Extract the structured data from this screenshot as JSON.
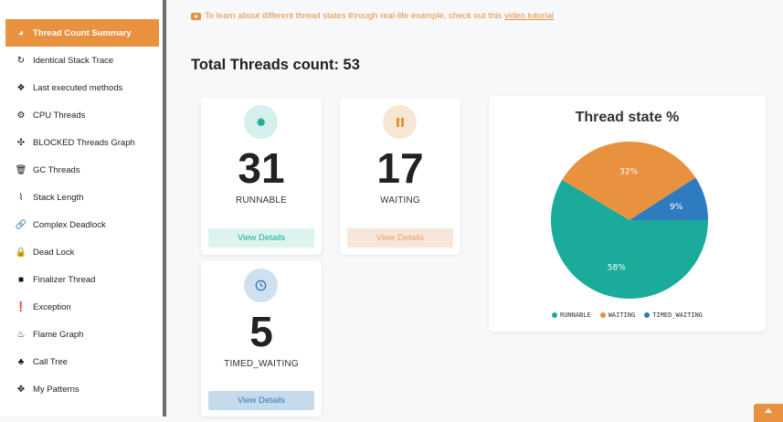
{
  "sidebar": {
    "items": [
      {
        "label": "Thread Count Summary",
        "icon": "dashboard-icon",
        "active": true
      },
      {
        "label": "Identical Stack Trace",
        "icon": "refresh-icon"
      },
      {
        "label": "Last executed methods",
        "icon": "cubes-icon"
      },
      {
        "label": "CPU Threads",
        "icon": "gears-icon"
      },
      {
        "label": "BLOCKED Threads Graph",
        "icon": "graph-icon"
      },
      {
        "label": "GC Threads",
        "icon": "trash-icon"
      },
      {
        "label": "Stack Length",
        "icon": "stairs-icon"
      },
      {
        "label": "Complex Deadlock",
        "icon": "link-icon"
      },
      {
        "label": "Dead Lock",
        "icon": "lock-icon"
      },
      {
        "label": "Finalizer Thread",
        "icon": "square-icon"
      },
      {
        "label": "Exception",
        "icon": "exclamation-icon"
      },
      {
        "label": "Flame Graph",
        "icon": "fire-icon"
      },
      {
        "label": "Call Tree",
        "icon": "tree-icon"
      },
      {
        "label": "My Patterns",
        "icon": "puzzle-icon"
      }
    ]
  },
  "notice": {
    "text": "To learn about different thread states through real-life example, check out this",
    "link": "video tutorial"
  },
  "total": "Total Threads count: 53",
  "cards": {
    "runnable": {
      "count": "31",
      "label": "RUNNABLE",
      "button": "View Details",
      "color": "#1aab9b"
    },
    "waiting": {
      "count": "17",
      "label": "WAITING",
      "button": "View Details",
      "color": "#e8913f"
    },
    "timed_waiting": {
      "count": "5",
      "label": "TIMED_WAITING",
      "button": "View Details",
      "color": "#2f7bbf"
    }
  },
  "chart_data": {
    "type": "pie",
    "title": "Thread state %",
    "categories": [
      "RUNNABLE",
      "WAITING",
      "TIMED_WAITING"
    ],
    "values": [
      58,
      32,
      9
    ],
    "colors": [
      "#1aab9b",
      "#e8913f",
      "#2f7bbf"
    ],
    "legend": "bottom"
  }
}
